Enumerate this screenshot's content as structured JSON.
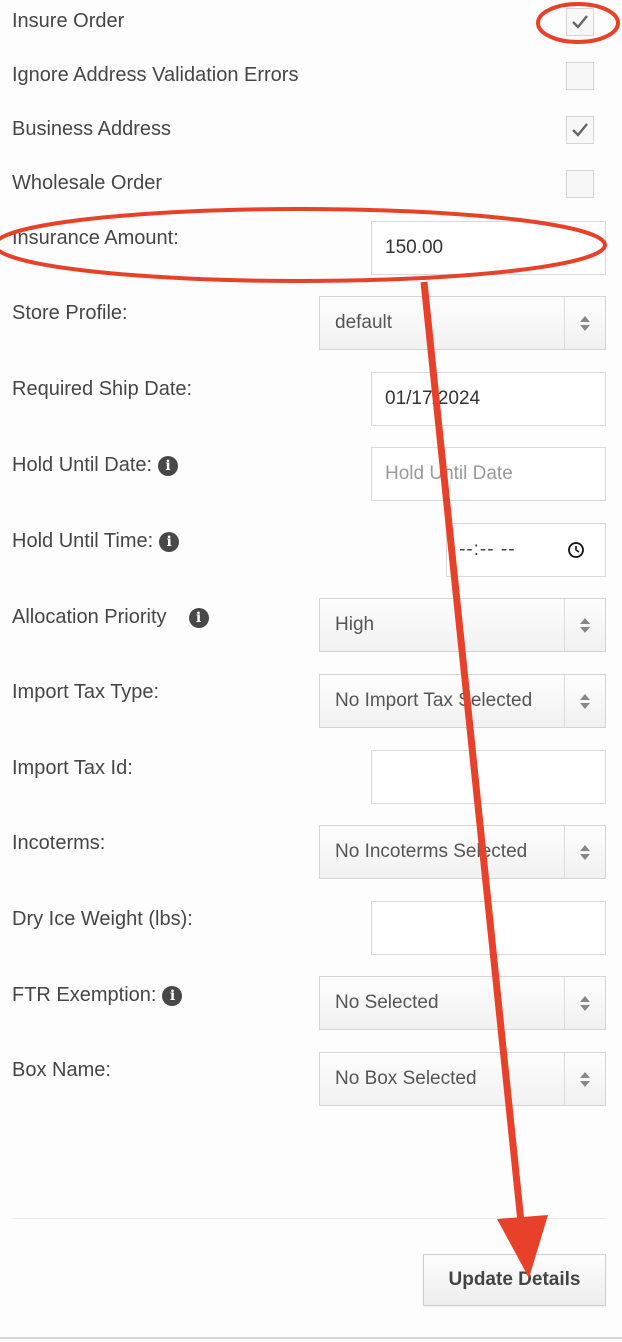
{
  "checkboxes": [
    {
      "label": "Insure Order",
      "checked": true
    },
    {
      "label": "Ignore Address Validation Errors",
      "checked": false
    },
    {
      "label": "Business Address",
      "checked": true
    },
    {
      "label": "Wholesale Order",
      "checked": false
    }
  ],
  "fields": {
    "insurance_amount": {
      "label": "Insurance Amount:",
      "value": "150.00"
    },
    "store_profile": {
      "label": "Store Profile:",
      "value": "default"
    },
    "required_ship_date": {
      "label": "Required Ship Date:",
      "value": "01/17/2024"
    },
    "hold_until_date": {
      "label": "Hold Until Date:",
      "placeholder": "Hold Until Date",
      "icon": "info-icon"
    },
    "hold_until_time": {
      "label": "Hold Until Time:",
      "value": "--:-- --",
      "icon": "info-icon"
    },
    "allocation_priority": {
      "label": "Allocation Priority",
      "value": "High",
      "icon": "info-icon"
    },
    "import_tax_type": {
      "label": "Import Tax Type:",
      "value": "No Import Tax Selected"
    },
    "import_tax_id": {
      "label": "Import Tax Id:",
      "value": ""
    },
    "incoterms": {
      "label": "Incoterms:",
      "value": "No Incoterms Selected"
    },
    "dry_ice_weight": {
      "label": "Dry Ice Weight (lbs):",
      "value": ""
    },
    "ftr_exemption": {
      "label": "FTR Exemption:",
      "value": "No Selected",
      "icon": "info-icon"
    },
    "box_name": {
      "label": "Box Name:",
      "value": "No Box Selected"
    }
  },
  "info_glyph": "i",
  "actions": {
    "update_label": "Update Details"
  },
  "annotation": {
    "color": "#e8412a"
  }
}
